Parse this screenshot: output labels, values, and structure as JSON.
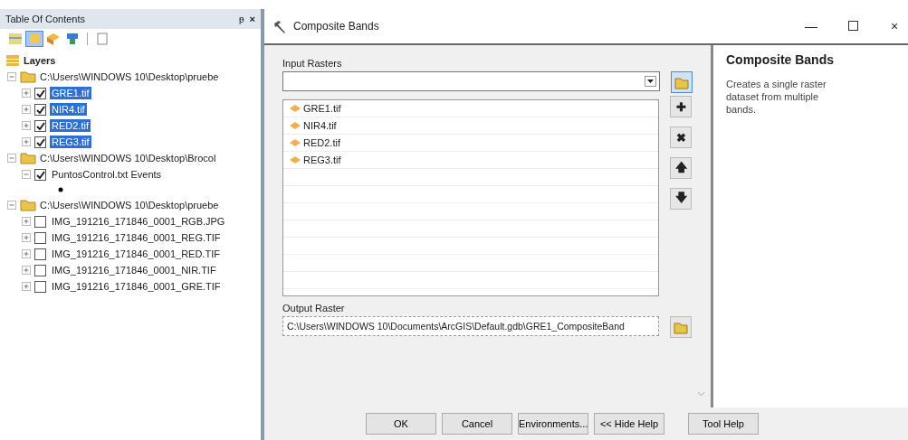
{
  "toc": {
    "title": "Table Of Contents",
    "pin": "ᵽ",
    "close": "×",
    "root": {
      "label": "Layers",
      "groups": [
        {
          "path": "C:\\Users\\WINDOWS 10\\Desktop\\pruebe",
          "expanded": true,
          "layers": [
            {
              "name": "GRE1.tif",
              "checked": true,
              "selected": true,
              "expanded": false
            },
            {
              "name": "NIR4.tif",
              "checked": true,
              "selected": true,
              "expanded": false
            },
            {
              "name": "RED2.tif",
              "checked": true,
              "selected": true,
              "expanded": false
            },
            {
              "name": "REG3.tif",
              "checked": true,
              "selected": true,
              "expanded": false
            }
          ]
        },
        {
          "path": "C:\\Users\\WINDOWS 10\\Desktop\\Brocol",
          "expanded": true,
          "layers": [
            {
              "name": "PuntosControl.txt Events",
              "checked": true,
              "selected": false,
              "expanded": true
            }
          ]
        },
        {
          "path": "C:\\Users\\WINDOWS 10\\Desktop\\pruebe",
          "expanded": true,
          "layers": [
            {
              "name": "IMG_191216_171846_0001_RGB.JPG",
              "checked": false,
              "selected": false,
              "expanded": false
            },
            {
              "name": "IMG_191216_171846_0001_REG.TIF",
              "checked": false,
              "selected": false,
              "expanded": false
            },
            {
              "name": "IMG_191216_171846_0001_RED.TIF",
              "checked": false,
              "selected": false,
              "expanded": false
            },
            {
              "name": "IMG_191216_171846_0001_NIR.TIF",
              "checked": false,
              "selected": false,
              "expanded": false
            },
            {
              "name": "IMG_191216_171846_0001_GRE.TIF",
              "checked": false,
              "selected": false,
              "expanded": false
            }
          ]
        }
      ]
    }
  },
  "dialog": {
    "title": "Composite Bands",
    "minimize": "—",
    "close": "×",
    "input_label": "Input Rasters",
    "rasters": [
      "GRE1.tif",
      "NIR4.tif",
      "RED2.tif",
      "REG3.tif"
    ],
    "list_buttons": [
      "✚",
      "✖",
      "🡅",
      "🡇"
    ],
    "output_label": "Output Raster",
    "output_value": "C:\\Users\\WINDOWS 10\\Documents\\ArcGIS\\Default.gdb\\GRE1_CompositeBand",
    "help": {
      "title": "Composite Bands",
      "text": "Creates a single raster dataset from multiple bands."
    },
    "buttons": [
      "OK",
      "Cancel",
      "Environments...",
      "<< Hide Help"
    ],
    "tool_help": "Tool Help"
  }
}
